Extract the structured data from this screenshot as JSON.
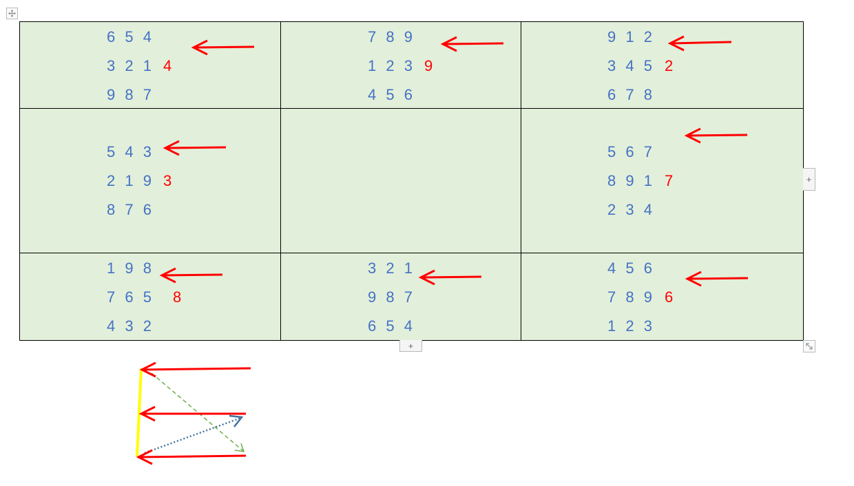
{
  "table": {
    "rows": [
      [
        {
          "lines": [
            "6 5 4",
            "3 2 1",
            "9 8 7"
          ],
          "label": "4",
          "has_arrow": true
        },
        {
          "lines": [
            "7 8 9",
            "1 2 3",
            "4 5 6"
          ],
          "label": "9",
          "has_arrow": true
        },
        {
          "lines": [
            "9 1 2",
            "3 4 5",
            "6 7 8"
          ],
          "label": "2",
          "has_arrow": true
        }
      ],
      [
        {
          "lines": [
            "5 4 3",
            "2 1 9",
            "8 7 6"
          ],
          "label": "3",
          "has_arrow": true
        },
        {
          "lines": [],
          "label": "",
          "has_arrow": false
        },
        {
          "lines": [
            "5 6 7",
            "8 9 1",
            "2 3 4"
          ],
          "label": "7",
          "has_arrow": true
        }
      ],
      [
        {
          "lines": [
            "1 9 8",
            "7 6 5",
            "4 3 2"
          ],
          "label": "8",
          "has_arrow": true
        },
        {
          "lines": [
            "3 2 1",
            "9 8 7",
            "6 5 4"
          ],
          "label": "",
          "has_arrow": true
        },
        {
          "lines": [
            "4 5 6",
            "7 8 9",
            "1 2 3"
          ],
          "label": "6",
          "has_arrow": true
        }
      ]
    ]
  },
  "controls": {
    "add_row": "+",
    "add_col": "+"
  },
  "colors": {
    "cell_bg": "#e2efda",
    "digits": "#4472c4",
    "label": "#ff0000",
    "arrow": "#ff0000",
    "yellow_line": "#ffff00",
    "green_dash": "#70ad47",
    "blue_dot": "#41719c"
  }
}
